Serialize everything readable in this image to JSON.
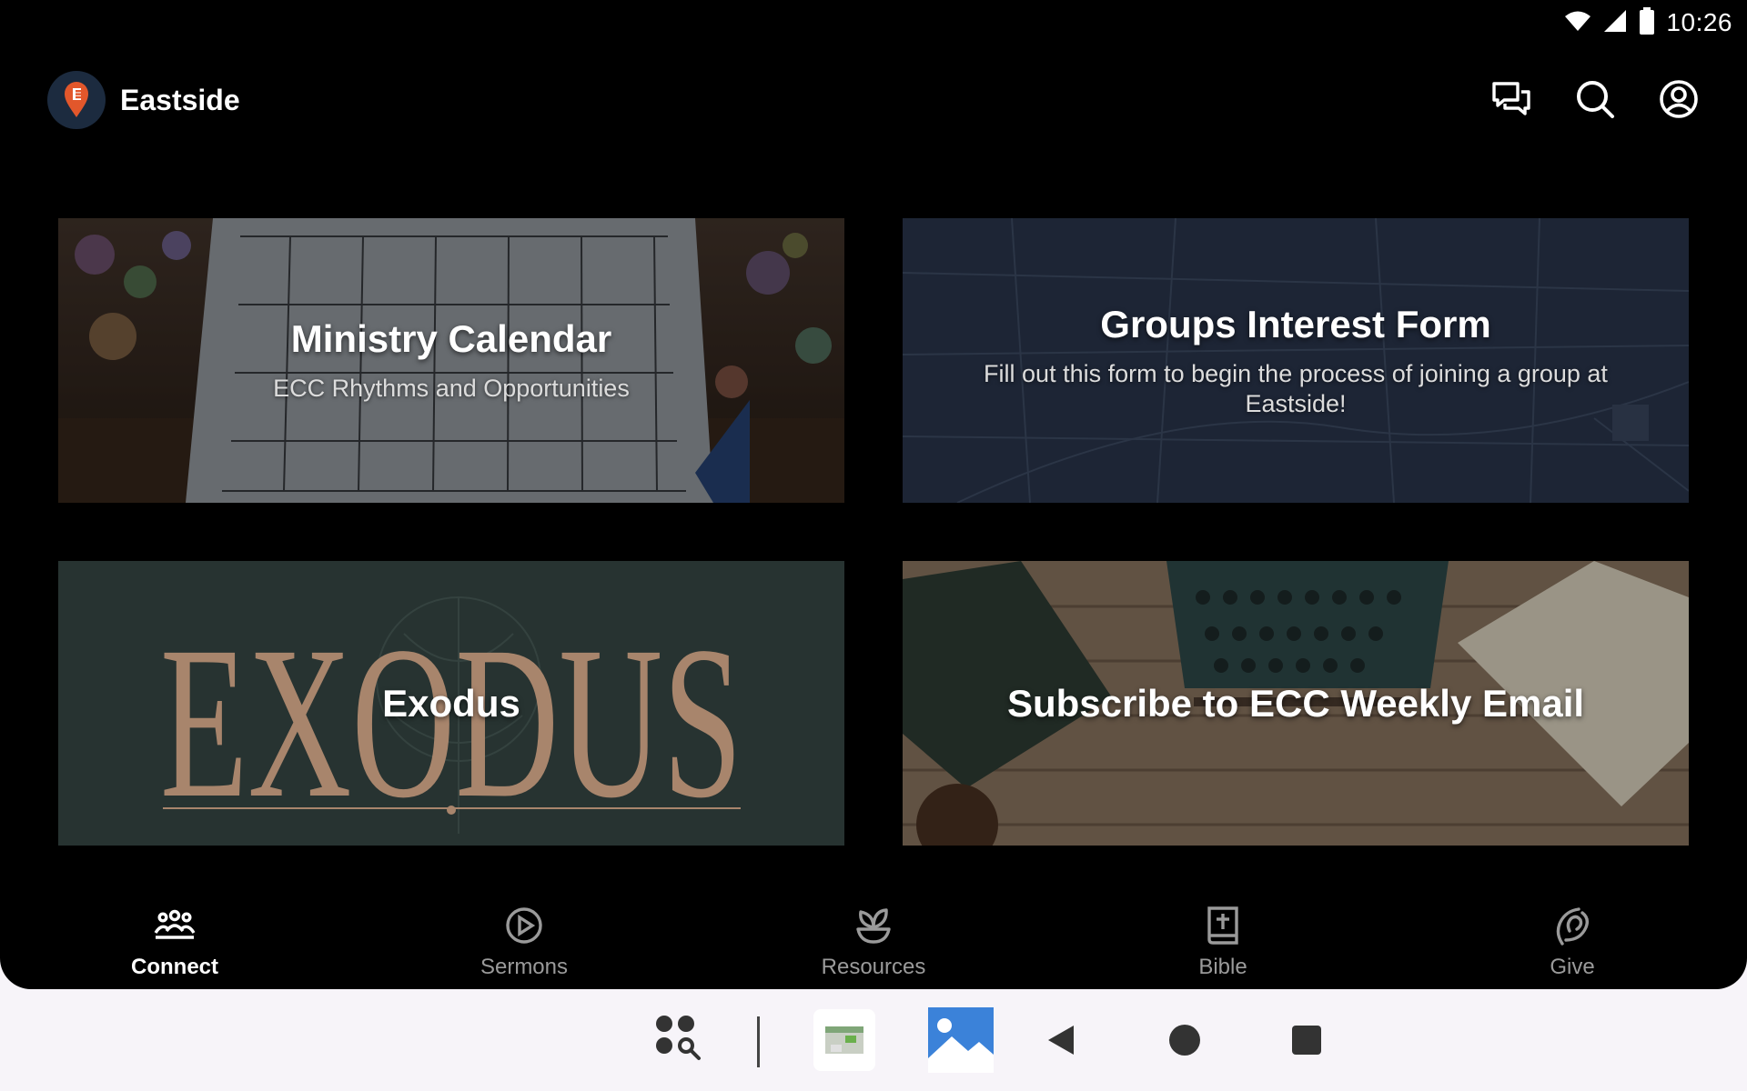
{
  "status_bar": {
    "time": "10:26"
  },
  "header": {
    "brand_name": "Eastside"
  },
  "cards": [
    {
      "title": "Ministry Calendar",
      "subtitle": "ECC Rhythms and Opportunities"
    },
    {
      "title": "Groups Interest Form",
      "subtitle": "Fill out this form to begin the process of joining a group at Eastside!"
    },
    {
      "title": "Exodus",
      "art_text": "EXODUS"
    },
    {
      "title": "Subscribe to ECC Weekly Email"
    }
  ],
  "bottom_nav": [
    {
      "label": "Connect",
      "icon": "people-icon",
      "active": true
    },
    {
      "label": "Sermons",
      "icon": "play-circle-icon",
      "active": false
    },
    {
      "label": "Resources",
      "icon": "sprout-icon",
      "active": false
    },
    {
      "label": "Bible",
      "icon": "bible-icon",
      "active": false
    },
    {
      "label": "Give",
      "icon": "give-icon",
      "active": false
    }
  ],
  "colors": {
    "background": "#000000",
    "accent_logo": "#e2572b",
    "exodus_art": "#a8856c",
    "groups_card": "#1d2535"
  }
}
